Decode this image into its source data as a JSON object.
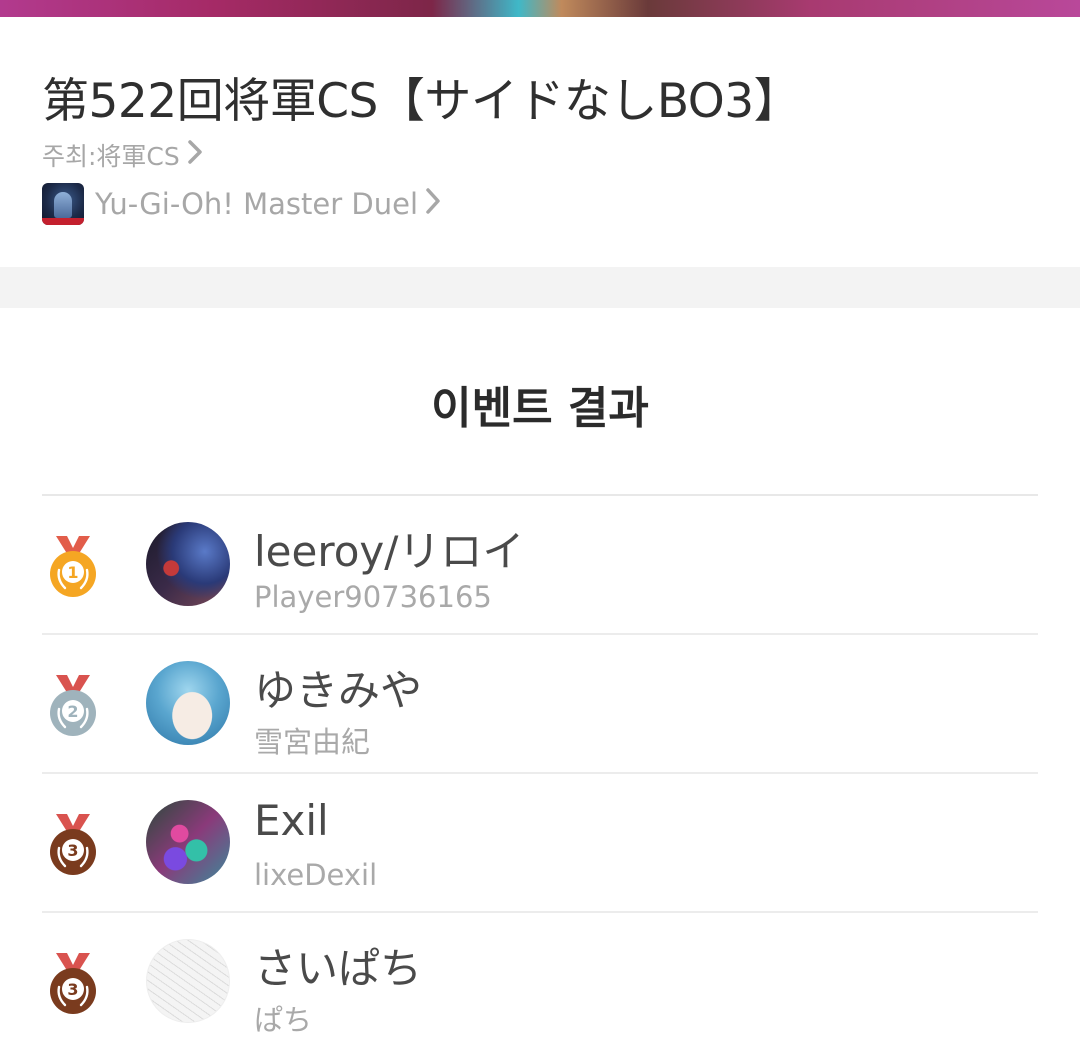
{
  "event": {
    "title": "第522回将軍CS【サイドなしBO3】",
    "host_label": "주최:将軍CS",
    "game_name": "Yu-Gi-Oh! Master Duel",
    "chevron": "❯"
  },
  "results": {
    "title": "이벤트 결과",
    "entries": [
      {
        "rank": "1",
        "name": "leeroy/リロイ",
        "player_id": "Player90736165",
        "medal": "gold"
      },
      {
        "rank": "2",
        "name": "ゆきみや",
        "player_id": "雪宮由紀",
        "medal": "silver"
      },
      {
        "rank": "3",
        "name": "Exil",
        "player_id": "lixeDexil",
        "medal": "bronze"
      },
      {
        "rank": "3",
        "name": "さいぱち",
        "player_id": "ぱち",
        "medal": "bronze"
      }
    ]
  },
  "colors": {
    "gold": "#f5a623",
    "gold_ribbon": "#e25d4a",
    "silver": "#9fb3bc",
    "bronze": "#7a3b1e",
    "ribbon": "#d9534f"
  },
  "icons": {
    "game": "master-duel-app-icon",
    "chevron": "chevron-right-icon",
    "medal": "medal-icon"
  }
}
